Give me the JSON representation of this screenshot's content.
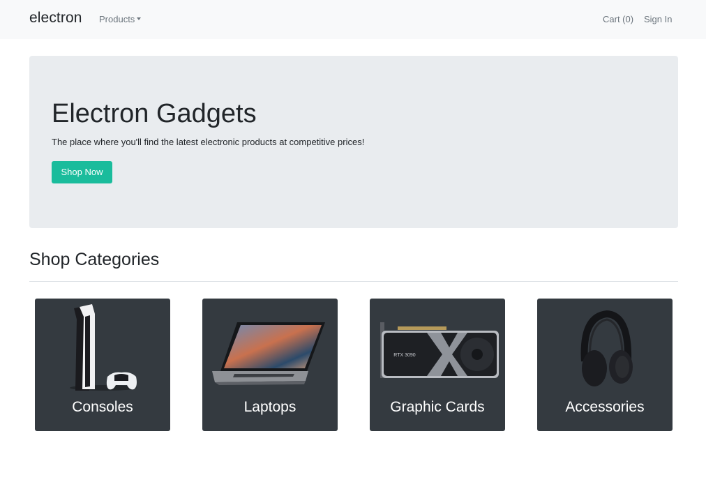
{
  "navbar": {
    "brand": "electron",
    "products_label": "Products",
    "cart_label": "Cart (0)",
    "signin_label": "Sign In"
  },
  "hero": {
    "title": "Electron Gadgets",
    "subtitle": "The place where you'll find the latest electronic products at competitive prices!",
    "button_label": "Shop Now"
  },
  "categories_section": {
    "title": "Shop Categories",
    "items": [
      {
        "label": "Consoles",
        "image": "game-console-image"
      },
      {
        "label": "Laptops",
        "image": "laptop-image"
      },
      {
        "label": "Graphic Cards",
        "image": "graphics-card-image",
        "image_text": "RTX 3090"
      },
      {
        "label": "Accessories",
        "image": "headphones-image"
      }
    ]
  },
  "colors": {
    "navbar_bg": "#f8f9fa",
    "hero_bg": "#e9ecef",
    "accent": "#1abc9c",
    "card_bg": "#343a40"
  }
}
